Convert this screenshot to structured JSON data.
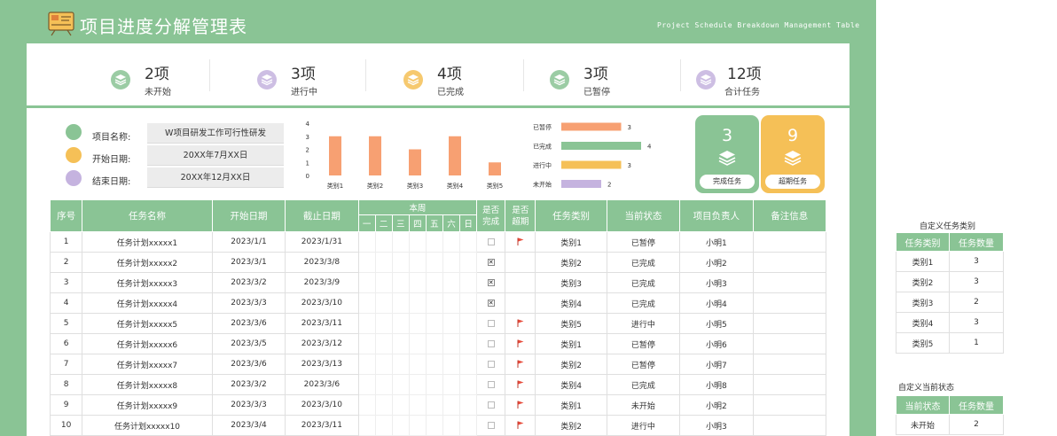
{
  "header": {
    "title": "项目进度分解管理表",
    "subtitle": "Project Schedule Breakdown Management Table"
  },
  "stats": [
    {
      "value": "2项",
      "label": "未开始",
      "color": "#8ac495",
      "icon": "layers-icon"
    },
    {
      "value": "3项",
      "label": "进行中",
      "color": "#c5b3df",
      "icon": "layers-icon"
    },
    {
      "value": "4项",
      "label": "已完成",
      "color": "#f5c057",
      "icon": "layers-icon"
    },
    {
      "value": "3项",
      "label": "已暂停",
      "color": "#8ac495",
      "icon": "layers-icon"
    },
    {
      "value": "12项",
      "label": "合计任务",
      "color": "#c5b3df",
      "icon": "layers-icon"
    }
  ],
  "project_info": [
    {
      "label": "项目名称:",
      "value": "W项目研发工作可行性研发",
      "icon": "cube-icon",
      "color": "#8ac495"
    },
    {
      "label": "开始日期:",
      "value": "20XX年7月XX日",
      "icon": "calendar-icon",
      "color": "#f5c057"
    },
    {
      "label": "结束日期:",
      "value": "20XX年12月XX日",
      "icon": "calendar-icon",
      "color": "#c5b3df"
    }
  ],
  "chart_data": [
    {
      "type": "bar",
      "categories": [
        "类别1",
        "类别2",
        "类别3",
        "类别4",
        "类别5"
      ],
      "values": [
        3,
        3,
        2,
        3,
        1
      ],
      "ylim": [
        0,
        4
      ],
      "yticks": [
        "0",
        "1",
        "2",
        "3",
        "4"
      ],
      "color": "#f7a072"
    },
    {
      "type": "bar",
      "orientation": "horizontal",
      "categories": [
        "已暂停",
        "已完成",
        "进行中",
        "未开始"
      ],
      "values": [
        3,
        4,
        3,
        2
      ],
      "colors": [
        "#f7a072",
        "#8ac495",
        "#f5c057",
        "#c5b3df"
      ],
      "xlim": [
        0,
        4
      ]
    }
  ],
  "cards": [
    {
      "value": "3",
      "label": "完成任务",
      "color": "#8ac495"
    },
    {
      "value": "9",
      "label": "超期任务",
      "color": "#f5c057"
    }
  ],
  "table": {
    "headers": {
      "index": "序号",
      "name": "任务名称",
      "start": "开始日期",
      "end": "截止日期",
      "week": "本周",
      "done": "是否完成",
      "overdue": "是否超期",
      "category": "任务类别",
      "status": "当前状态",
      "owner": "项目负责人",
      "note": "备注信息"
    },
    "weekdays": [
      "一",
      "二",
      "三",
      "四",
      "五",
      "六",
      "日"
    ],
    "rows": [
      {
        "index": "1",
        "name": "任务计划xxxxx1",
        "start": "2023/1/1",
        "end": "2023/1/31",
        "done": false,
        "overdue": true,
        "category": "类别1",
        "status": "已暂停",
        "owner": "小明1",
        "note": ""
      },
      {
        "index": "2",
        "name": "任务计划xxxxx2",
        "start": "2023/3/1",
        "end": "2023/3/8",
        "done": true,
        "overdue": false,
        "category": "类别2",
        "status": "已完成",
        "owner": "小明2",
        "note": ""
      },
      {
        "index": "3",
        "name": "任务计划xxxxx3",
        "start": "2023/3/2",
        "end": "2023/3/9",
        "done": true,
        "overdue": false,
        "category": "类别3",
        "status": "已完成",
        "owner": "小明3",
        "note": ""
      },
      {
        "index": "4",
        "name": "任务计划xxxxx4",
        "start": "2023/3/3",
        "end": "2023/3/10",
        "done": true,
        "overdue": false,
        "category": "类别4",
        "status": "已完成",
        "owner": "小明4",
        "note": ""
      },
      {
        "index": "5",
        "name": "任务计划xxxxx5",
        "start": "2023/3/6",
        "end": "2023/3/11",
        "done": false,
        "overdue": true,
        "category": "类别5",
        "status": "进行中",
        "owner": "小明5",
        "note": ""
      },
      {
        "index": "6",
        "name": "任务计划xxxxx6",
        "start": "2023/3/5",
        "end": "2023/3/12",
        "done": false,
        "overdue": true,
        "category": "类别1",
        "status": "已暂停",
        "owner": "小明6",
        "note": ""
      },
      {
        "index": "7",
        "name": "任务计划xxxxx7",
        "start": "2023/3/6",
        "end": "2023/3/13",
        "done": false,
        "overdue": true,
        "category": "类别2",
        "status": "已暂停",
        "owner": "小明7",
        "note": ""
      },
      {
        "index": "8",
        "name": "任务计划xxxxx8",
        "start": "2023/3/2",
        "end": "2023/3/6",
        "done": false,
        "overdue": true,
        "category": "类别4",
        "status": "已完成",
        "owner": "小明8",
        "note": ""
      },
      {
        "index": "9",
        "name": "任务计划xxxxx9",
        "start": "2023/3/3",
        "end": "2023/3/10",
        "done": false,
        "overdue": true,
        "category": "类别1",
        "status": "未开始",
        "owner": "小明2",
        "note": ""
      },
      {
        "index": "10",
        "name": "任务计划xxxxx10",
        "start": "2023/3/4",
        "end": "2023/3/11",
        "done": false,
        "overdue": true,
        "category": "类别2",
        "status": "进行中",
        "owner": "小明3",
        "note": ""
      }
    ]
  },
  "category_table": {
    "title": "自定义任务类别",
    "headers": [
      "任务类别",
      "任务数量"
    ],
    "rows": [
      [
        "类别1",
        "3"
      ],
      [
        "类别2",
        "3"
      ],
      [
        "类别3",
        "2"
      ],
      [
        "类别4",
        "3"
      ],
      [
        "类别5",
        "1"
      ]
    ]
  },
  "status_table": {
    "title": "自定义当前状态",
    "headers": [
      "当前状态",
      "任务数量"
    ],
    "rows": [
      [
        "未开始",
        "2"
      ]
    ]
  }
}
